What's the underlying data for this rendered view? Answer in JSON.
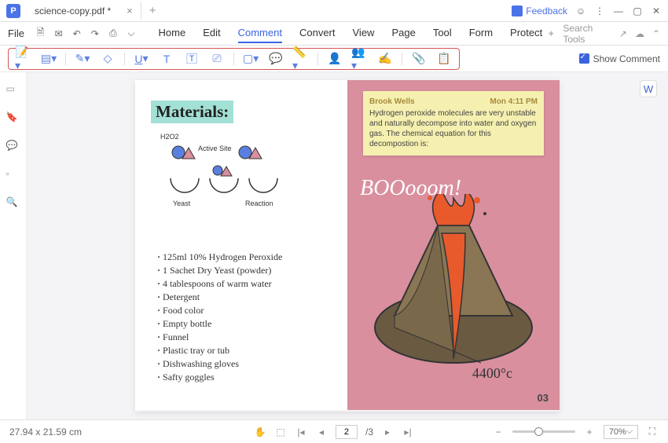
{
  "titlebar": {
    "app_glyph": "P",
    "tab_name": "science-copy.pdf *",
    "feedback": "Feedback"
  },
  "menu": {
    "file": "File",
    "items": [
      "Home",
      "Edit",
      "Comment",
      "Convert",
      "View",
      "Page",
      "Tool",
      "Form",
      "Protect"
    ],
    "active": 2,
    "search_ph": "Search Tools"
  },
  "toolbar": {
    "show_comment": "Show Comment"
  },
  "doc": {
    "materials_title": "Materials:",
    "diagram": {
      "h2o2": "H2O2",
      "active": "Active Site",
      "yeast": "Yeast",
      "reaction": "Reaction"
    },
    "list": [
      "125ml 10% Hydrogen Peroxide",
      "1 Sachet Dry Yeast (powder)",
      "4 tablespoons of warm water",
      "Detergent",
      "Food color",
      "Empty bottle",
      "Funnel",
      "Plastic tray or tub",
      "Dishwashing gloves",
      "Safty goggles"
    ],
    "note": {
      "author": "Brook Wells",
      "time": "Mon 4:11 PM",
      "body": "Hydrogen peroxide molecules are very unstable and naturally decompose into water and oxygen gas. The chemical equation for this decompostion is:"
    },
    "boom": "BOOooom!",
    "temp": "4400°c",
    "page_num": "03"
  },
  "status": {
    "dims": "27.94 x 21.59 cm",
    "page_current": "2",
    "page_total": "/3",
    "zoom": "70%"
  }
}
